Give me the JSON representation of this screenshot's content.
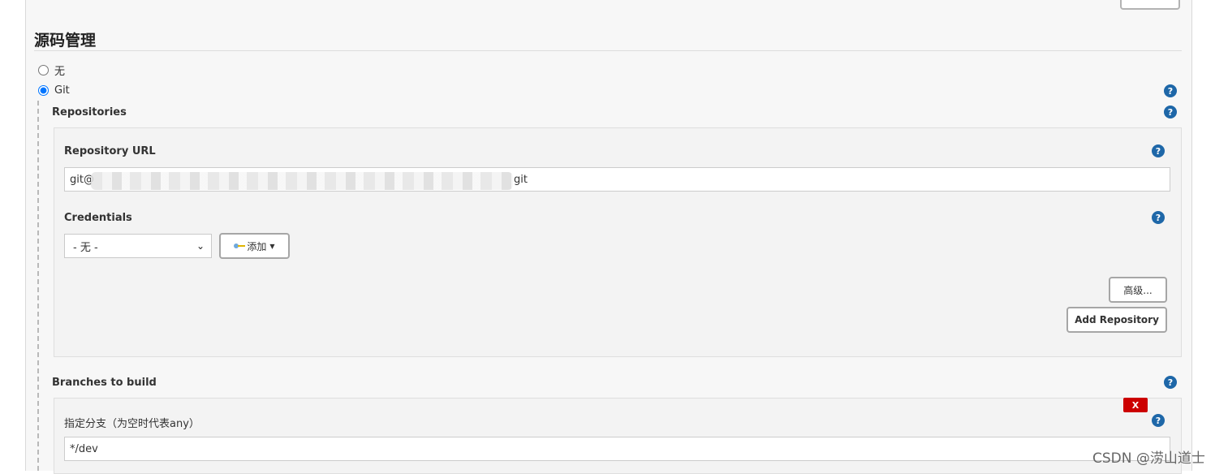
{
  "section": {
    "title": "源码管理"
  },
  "scm_options": [
    {
      "label": "无",
      "selected": false
    },
    {
      "label": "Git",
      "selected": true
    }
  ],
  "git": {
    "repositories_label": "Repositories",
    "repo_url_label": "Repository URL",
    "repo_url_value_start": "git@",
    "repo_url_value_end": "git",
    "credentials_label": "Credentials",
    "credentials_selected": "- 无 -",
    "add_button": "添加",
    "advanced_button": "高级...",
    "add_repository_button": "Add Repository",
    "branches_label": "Branches to build",
    "branch_specifier_label": "指定分支（为空时代表any）",
    "branch_specifier_value": "*/dev",
    "delete_branch_button": "X"
  },
  "help_glyph": "?",
  "watermark": "CSDN @涝山道士",
  "colors": {
    "help_icon": "#1e67a8",
    "delete_button": "#cc0000",
    "panel_bg": "#f7f7f7"
  }
}
